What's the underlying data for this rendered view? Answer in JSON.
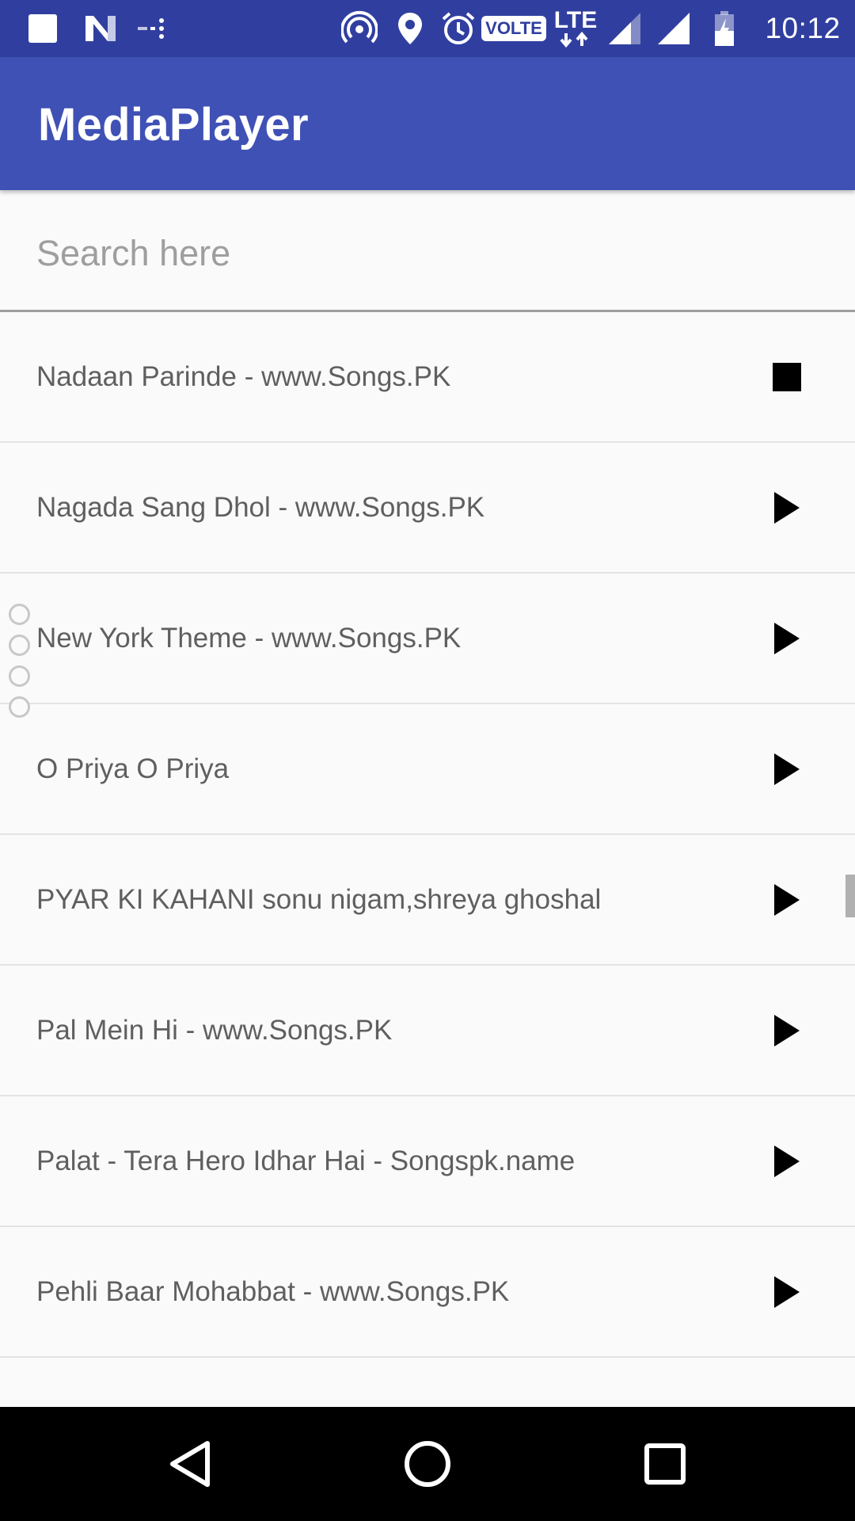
{
  "status_bar": {
    "time": "10:12",
    "volte_label": "VOLTE",
    "lte_label": "LTE",
    "icons": [
      "notification-square-icon",
      "n-icon",
      "cast-dots-icon",
      "hotspot-icon",
      "location-icon",
      "alarm-icon",
      "volte-icon",
      "lte-icon",
      "signal-icon",
      "signal-icon",
      "battery-charging-icon"
    ]
  },
  "app_bar": {
    "title": "MediaPlayer"
  },
  "search": {
    "placeholder": "Search here",
    "value": ""
  },
  "songs": [
    {
      "title": "Nadaan Parinde - www.Songs.PK",
      "action_icon": "stop-icon"
    },
    {
      "title": "Nagada Sang Dhol - www.Songs.PK",
      "action_icon": "play-icon"
    },
    {
      "title": "New York Theme - www.Songs.PK",
      "action_icon": "play-icon"
    },
    {
      "title": "O Priya O Priya",
      "action_icon": "play-icon"
    },
    {
      "title": "PYAR KI KAHANI sonu nigam,shreya ghoshal",
      "action_icon": "play-icon"
    },
    {
      "title": "Pal Mein Hi - www.Songs.PK",
      "action_icon": "play-icon"
    },
    {
      "title": "Palat - Tera Hero Idhar Hai - Songspk.name",
      "action_icon": "play-icon"
    },
    {
      "title": "Pehli Baar Mohabbat - www.Songs.PK",
      "action_icon": "play-icon"
    },
    {
      "title": "",
      "action_icon": "play-icon"
    }
  ],
  "nav_bar": {
    "buttons": [
      "back-icon",
      "home-icon",
      "recents-icon"
    ]
  },
  "colors": {
    "status_bar": "#303f9f",
    "app_bar": "#3f51b5",
    "background": "#fafafa",
    "song_text": "#5f5f5f",
    "placeholder": "#9e9e9e"
  }
}
